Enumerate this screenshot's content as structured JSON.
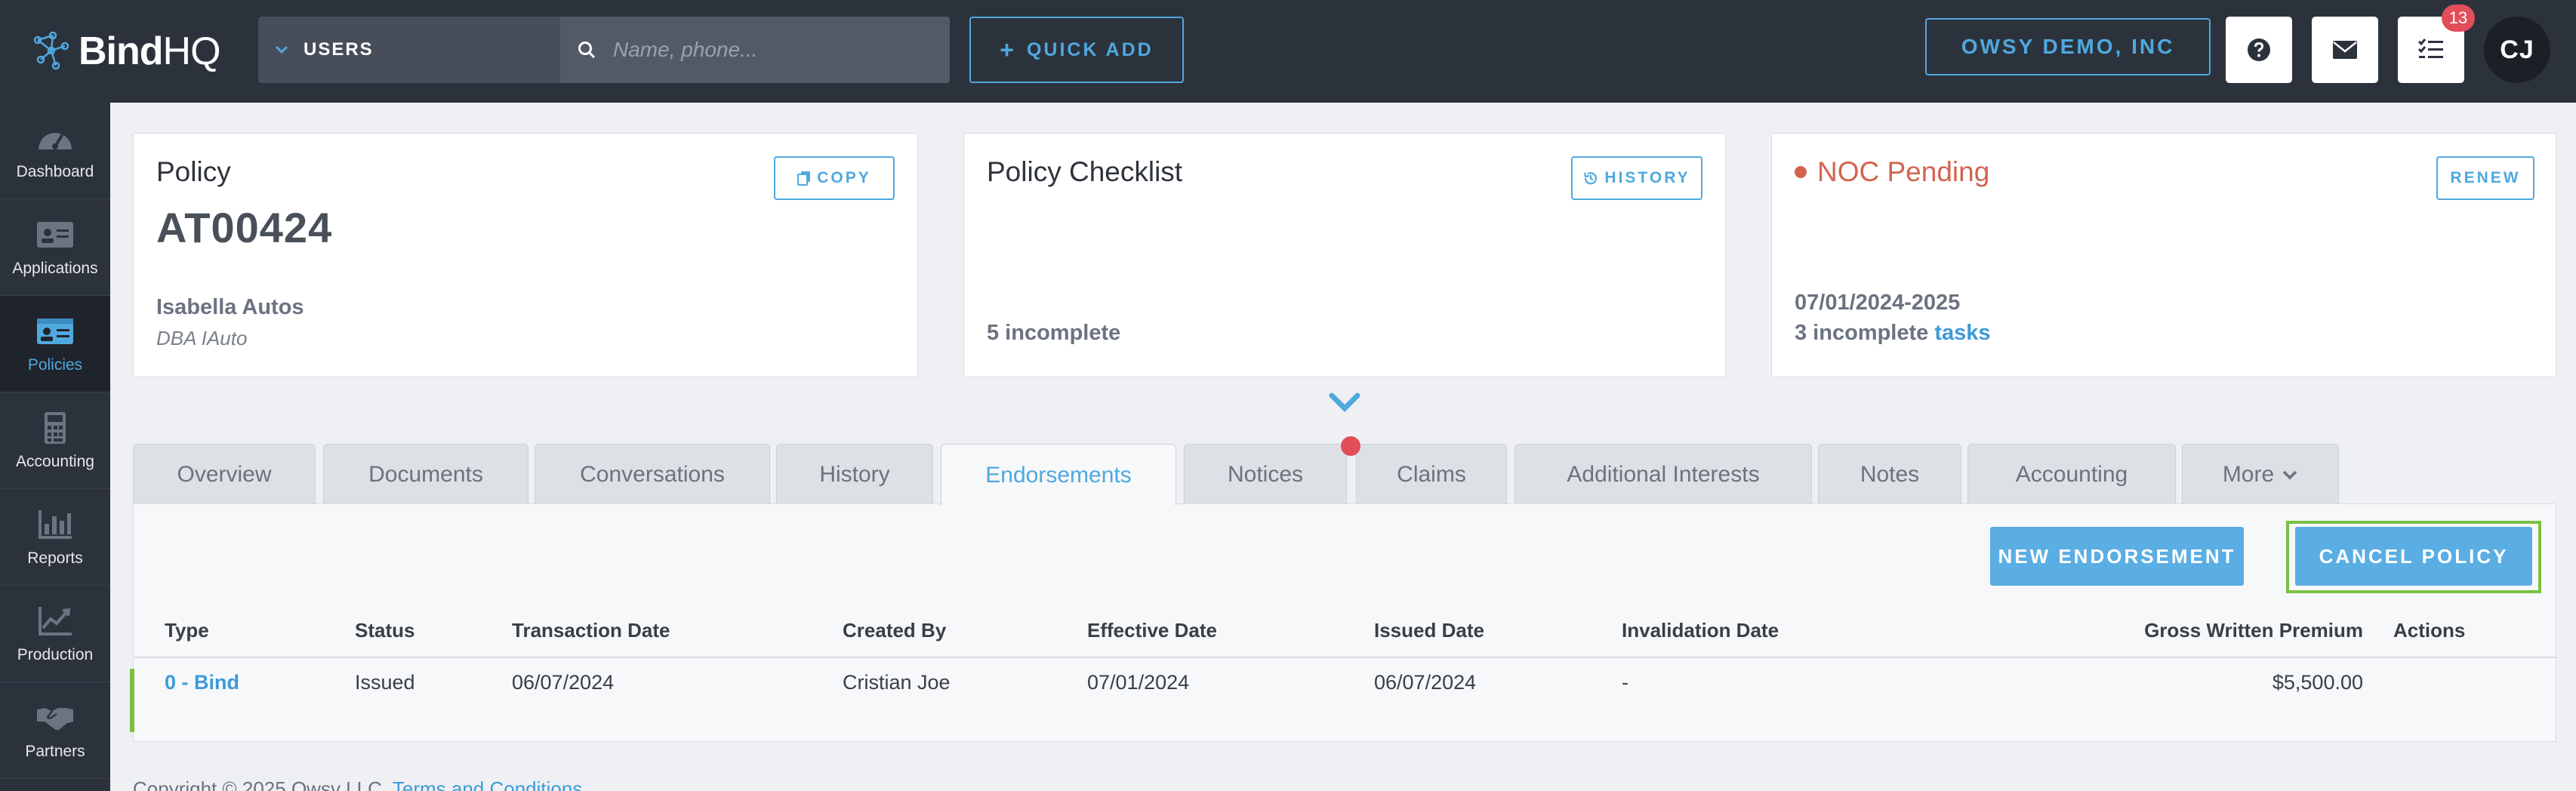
{
  "header": {
    "logo_prefix": "Bind",
    "logo_suffix": "HQ",
    "search_type": "USERS",
    "search_placeholder": "Name, phone...",
    "quick_add": "QUICK ADD",
    "org": "OWSY DEMO, INC",
    "tasks_badge": "13",
    "avatar": "CJ"
  },
  "sidebar": {
    "items": [
      {
        "label": "Dashboard"
      },
      {
        "label": "Applications"
      },
      {
        "label": "Policies"
      },
      {
        "label": "Accounting"
      },
      {
        "label": "Reports"
      },
      {
        "label": "Production"
      },
      {
        "label": "Partners"
      }
    ]
  },
  "policy_card": {
    "title": "Policy",
    "copy_label": "COPY",
    "policy_number": "AT00424",
    "insured": "Isabella Autos",
    "dba": "DBA IAuto"
  },
  "checklist_card": {
    "title": "Policy Checklist",
    "history_label": "HISTORY",
    "incomplete": "5 incomplete"
  },
  "noc_card": {
    "title": "NOC Pending",
    "renew_label": "RENEW",
    "term": "07/01/2024-2025",
    "incomplete": "3 incomplete",
    "tasks_link": "tasks"
  },
  "tabs": [
    {
      "label": "Overview"
    },
    {
      "label": "Documents"
    },
    {
      "label": "Conversations"
    },
    {
      "label": "History"
    },
    {
      "label": "Endorsements"
    },
    {
      "label": "Notices"
    },
    {
      "label": "Claims"
    },
    {
      "label": "Additional Interests"
    },
    {
      "label": "Notes"
    },
    {
      "label": "Accounting"
    },
    {
      "label": "More"
    }
  ],
  "active_tab": "Endorsements",
  "actions": {
    "new_endorsement": "NEW ENDORSEMENT",
    "cancel_policy": "CANCEL POLICY"
  },
  "table": {
    "headers": [
      "Type",
      "Status",
      "Transaction Date",
      "Created By",
      "Effective Date",
      "Issued Date",
      "Invalidation Date",
      "Gross Written Premium",
      "Actions"
    ],
    "rows": [
      [
        "0 - Bind",
        "Issued",
        "06/07/2024",
        "Cristian Joe",
        "07/01/2024",
        "06/07/2024",
        "-",
        "$5,500.00",
        ""
      ]
    ]
  },
  "footer": {
    "copyright": "Copyright © 2025 Owsy LLC.",
    "terms_link": "Terms and Conditions"
  },
  "colors": {
    "accent": "#4fa8de",
    "nav_bg": "#2c323c",
    "noc": "#d2644f",
    "badge": "#e24d5a",
    "highlight": "#7ac143"
  }
}
